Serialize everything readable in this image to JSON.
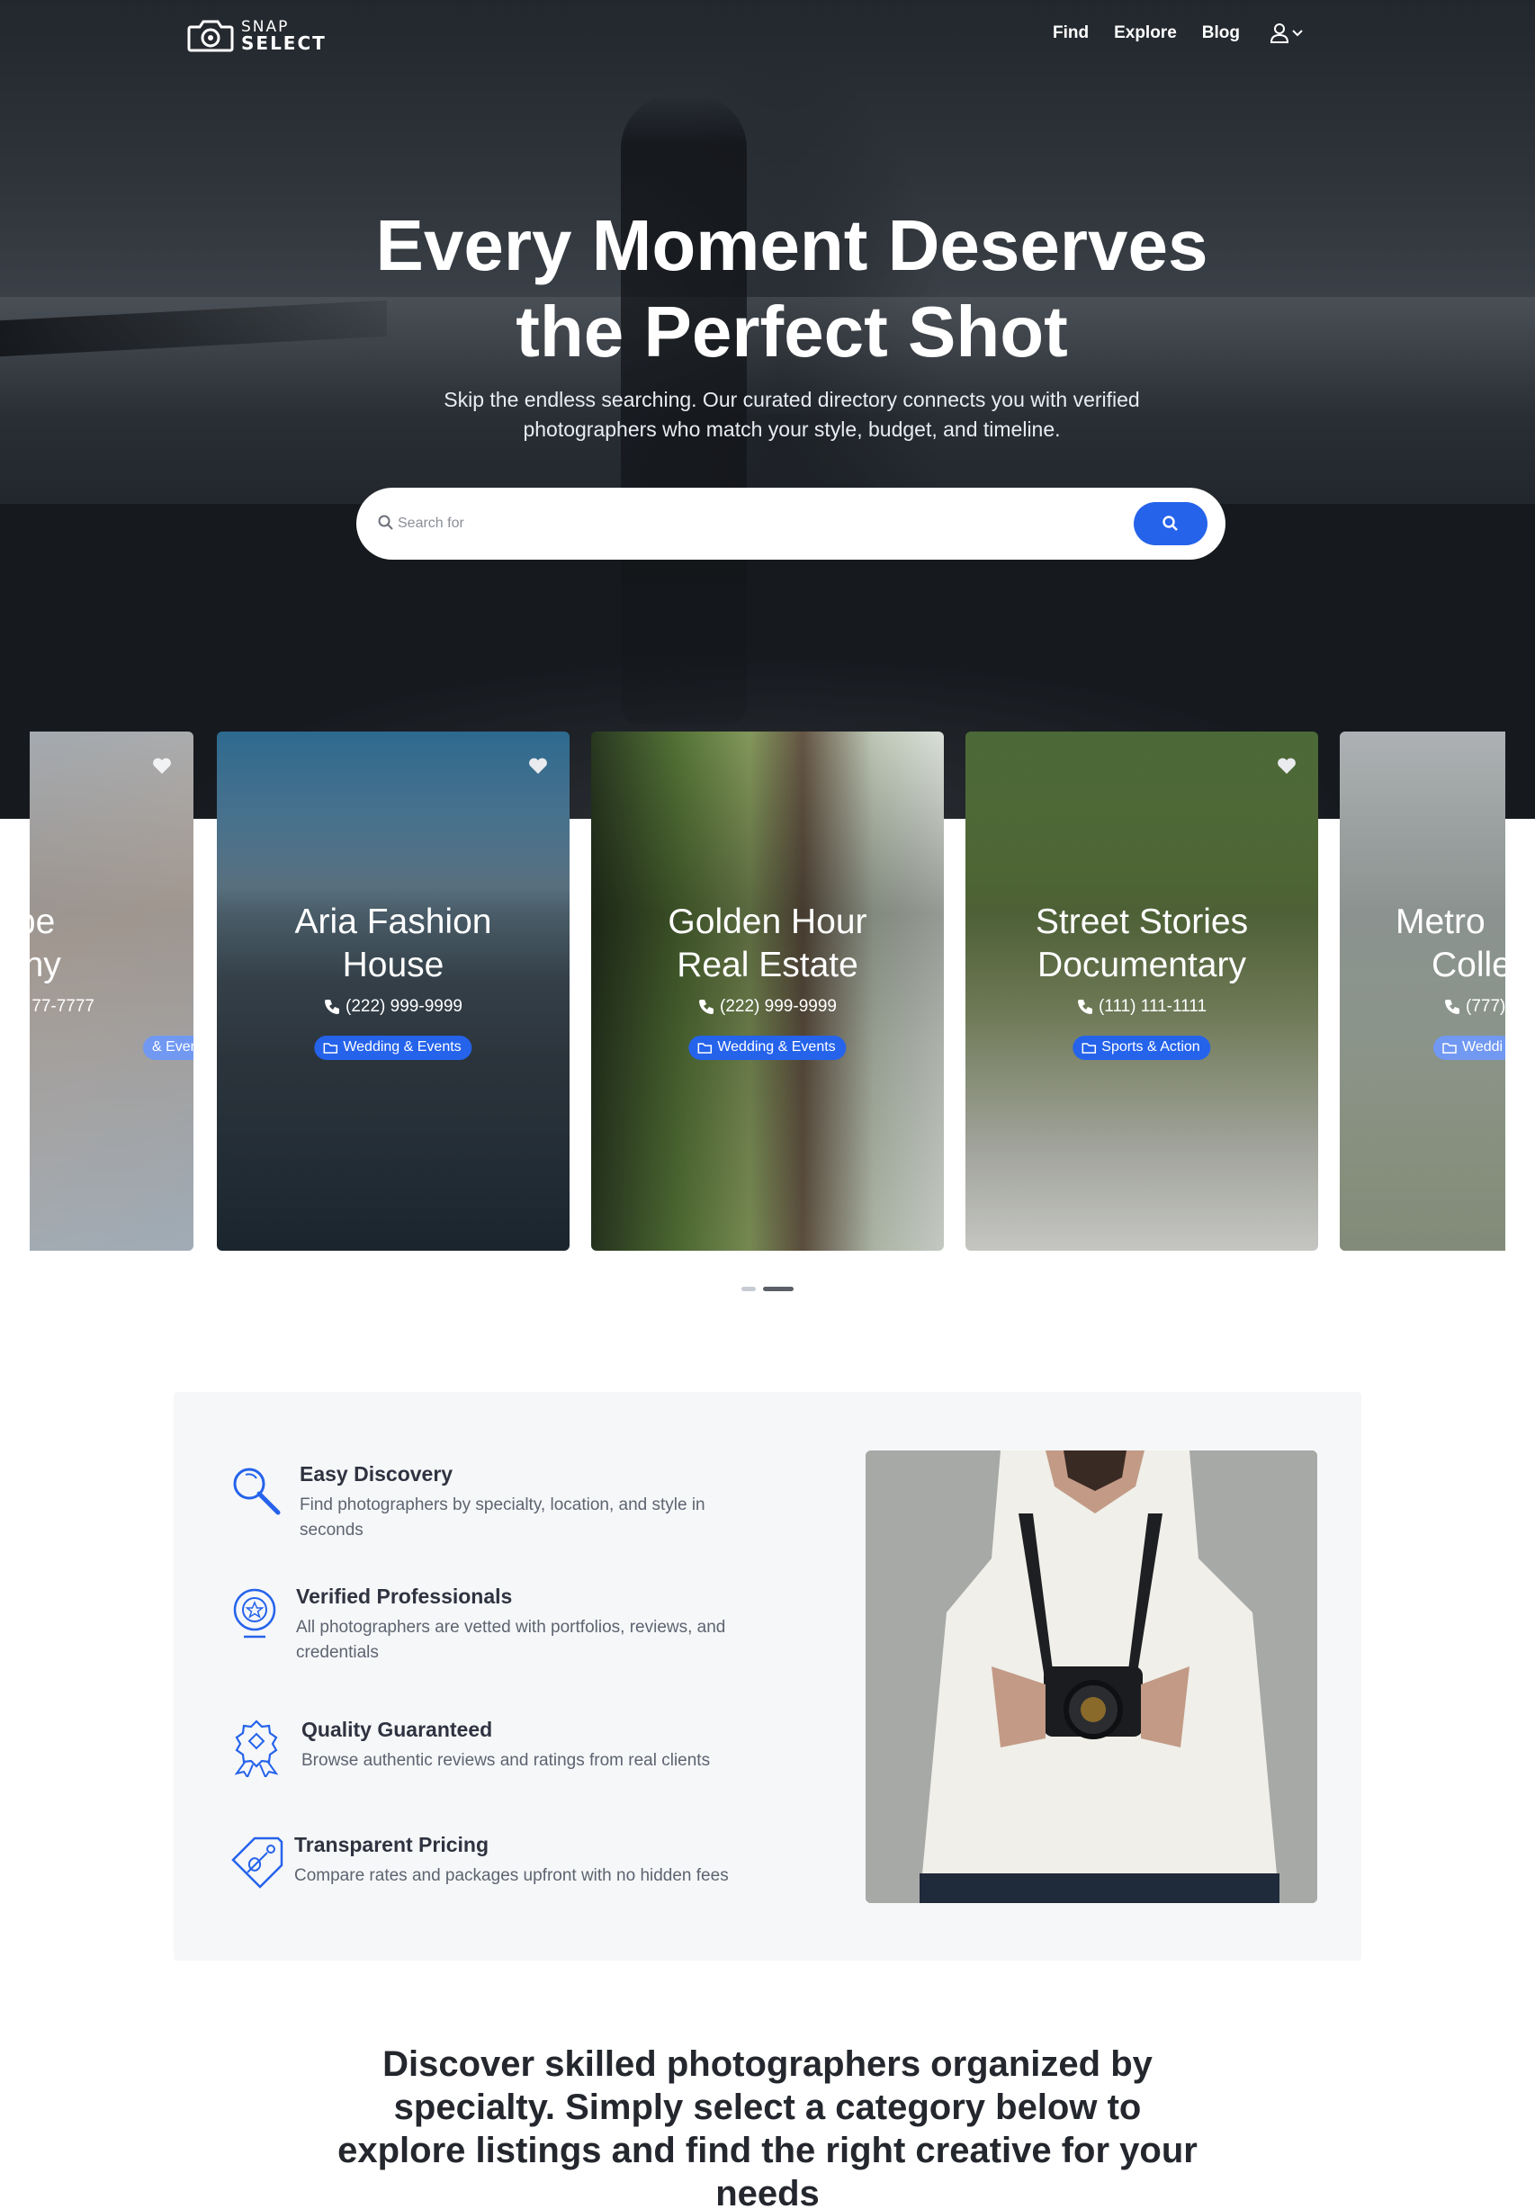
{
  "brand": {
    "line1": "SNAP",
    "line2": "SELECT"
  },
  "nav": {
    "links": [
      "Find",
      "Explore",
      "Blog"
    ]
  },
  "hero": {
    "title_line1": "Every Moment Deserves",
    "title_line2": "the Perfect Shot",
    "subtitle": "Skip the endless searching. Our curated directory connects you with verified photographers who match your style, budget, and timeline.",
    "search_placeholder": "Search for"
  },
  "cards": [
    {
      "name_l1": "cape",
      "name_l2": "raphy",
      "phone": "77-7777",
      "category": "& Events"
    },
    {
      "name_l1": "Aria Fashion",
      "name_l2": "House",
      "phone": "(222) 999-9999",
      "category": "Wedding & Events"
    },
    {
      "name_l1": "Golden Hour",
      "name_l2": "Real Estate",
      "phone": "(222) 999-9999",
      "category": "Wedding & Events"
    },
    {
      "name_l1": "Street Stories",
      "name_l2": "Documentary",
      "phone": "(111) 111-1111",
      "category": "Sports & Action"
    },
    {
      "name_l1": "Metro",
      "name_l2": "Colle",
      "phone": "(777)",
      "category": "Weddi"
    }
  ],
  "features": [
    {
      "title": "Easy Discovery",
      "desc": "Find photographers by specialty, location, and style in seconds",
      "icon": "magnifier-icon"
    },
    {
      "title": "Verified Professionals",
      "desc": "All photographers are vetted with portfolios, reviews, and credentials",
      "icon": "verified-badge-icon"
    },
    {
      "title": "Quality Guaranteed",
      "desc": "Browse authentic reviews and ratings from real clients",
      "icon": "award-ribbon-icon"
    },
    {
      "title": "Transparent Pricing",
      "desc": "Compare rates and packages upfront with no hidden fees",
      "icon": "price-tag-icon"
    }
  ],
  "discover": {
    "line1": "Discover skilled photographers organized by",
    "line2": "specialty. Simply select a category below to",
    "line3": "explore listings and find the right creative for your",
    "line4": "needs"
  },
  "colors": {
    "accent": "#2563eb",
    "panel": "#f6f7f9"
  }
}
